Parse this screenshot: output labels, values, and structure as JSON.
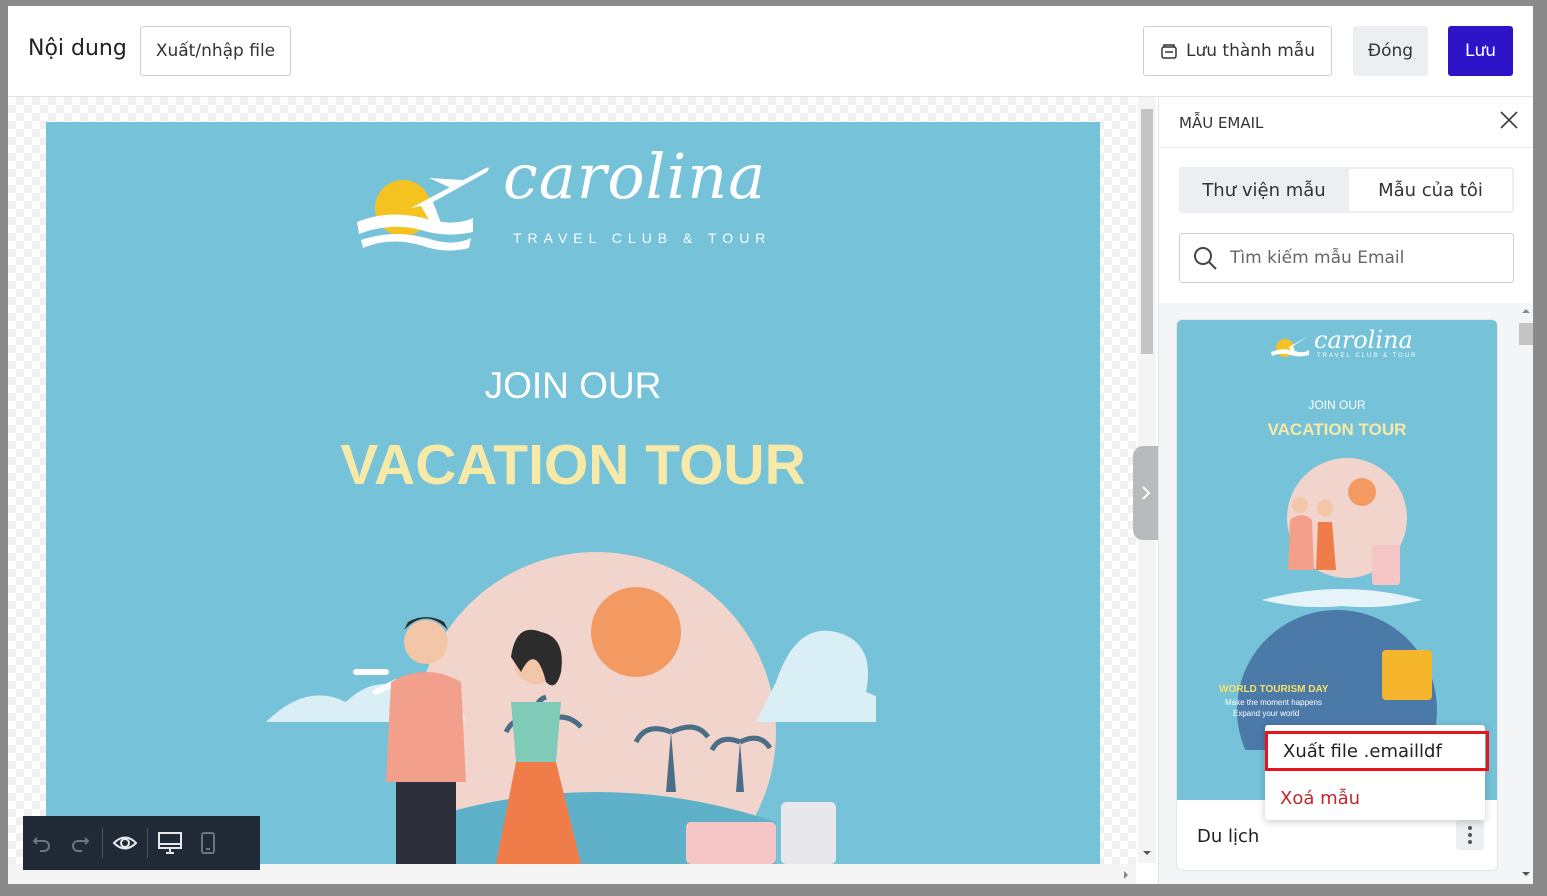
{
  "header": {
    "title": "Nội dung",
    "export_import_label": "Xuất/nhập file",
    "save_template_label": "Lưu thành mẫu",
    "close_label": "Đóng",
    "save_label": "Lưu"
  },
  "email": {
    "logo_name": "carolina",
    "logo_tagline": "TRAVEL CLUB & TOUR",
    "headline_small": "JOIN OUR",
    "headline_big": "VACATION TOUR"
  },
  "panel": {
    "title": "MẪU EMAIL",
    "tabs": [
      {
        "label": "Thư viện mẫu"
      },
      {
        "label": "Mẫu của tôi"
      }
    ],
    "search_placeholder": "Tìm kiếm mẫu Email",
    "template": {
      "name": "Du lịch",
      "thumb_logo": "carolina",
      "thumb_tagline": "TRAVEL CLUB & TOUR",
      "thumb_join": "JOIN OUR",
      "thumb_vacation": "VACATION TOUR",
      "thumb_world": "WORLD TOURISM DAY",
      "thumb_line1": "Make the moment happens",
      "thumb_line2": "Expand your world"
    }
  },
  "context_menu": {
    "export_label": "Xuất file .emailldf",
    "delete_label": "Xoá mẫu"
  },
  "colors": {
    "email_bg": "#75c2d9",
    "accent_yellow": "#f7e9a8",
    "primary": "#2d14c8",
    "danger": "#c0282a",
    "highlight": "#e8141b"
  }
}
